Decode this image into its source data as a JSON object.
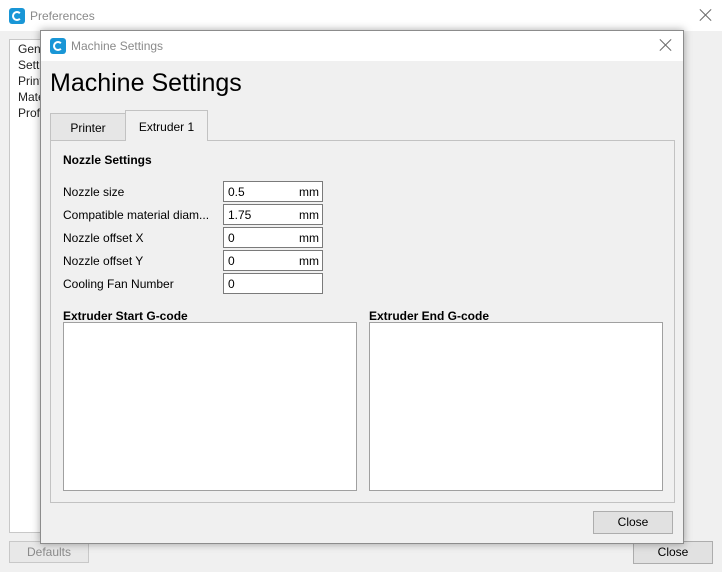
{
  "preferences": {
    "title": "Preferences",
    "sidebar_items": [
      "Gen",
      "Sett",
      "Print",
      "Mate",
      "Prof"
    ],
    "defaults_label": "Defaults",
    "close_label": "Close"
  },
  "dialog": {
    "window_title": "Machine Settings",
    "heading": "Machine Settings",
    "tabs": [
      {
        "label": "Printer",
        "active": false
      },
      {
        "label": "Extruder 1",
        "active": true
      }
    ],
    "nozzle_section": "Nozzle Settings",
    "fields": [
      {
        "label": "Nozzle size",
        "value": "0.5",
        "unit": "mm"
      },
      {
        "label": "Compatible material diam...",
        "value": "1.75",
        "unit": "mm"
      },
      {
        "label": "Nozzle offset X",
        "value": "0",
        "unit": "mm"
      },
      {
        "label": "Nozzle offset Y",
        "value": "0",
        "unit": "mm"
      },
      {
        "label": "Cooling Fan Number",
        "value": "0",
        "unit": ""
      }
    ],
    "start_gcode_label": "Extruder Start G-code",
    "end_gcode_label": "Extruder End G-code",
    "start_gcode": "",
    "end_gcode": "",
    "close_label": "Close"
  }
}
